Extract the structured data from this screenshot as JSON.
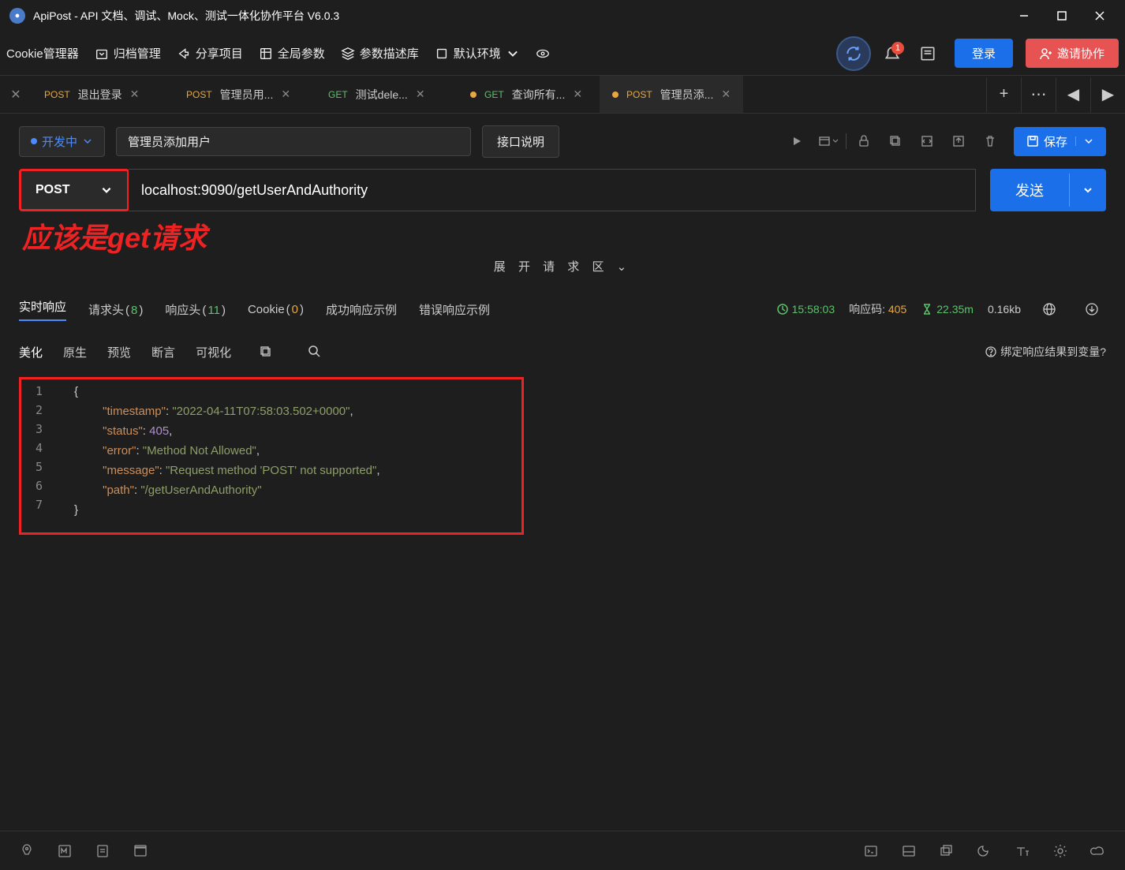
{
  "title": "ApiPost - API 文档、调试、Mock、测试一体化协作平台 V6.0.3",
  "toolbar": {
    "cookie_manager": "Cookie管理器",
    "archive": "归档管理",
    "share": "分享项目",
    "global_params": "全局参数",
    "param_lib": "参数描述库",
    "env": "默认环境",
    "login": "登录",
    "invite": "邀请协作",
    "badge": "1"
  },
  "tabs": [
    {
      "method": "POST",
      "method_class": "post",
      "label": "退出登录",
      "dirty": false,
      "active": false
    },
    {
      "method": "POST",
      "method_class": "post",
      "label": "管理员用...",
      "dirty": false,
      "active": false
    },
    {
      "method": "GET",
      "method_class": "get",
      "label": "测试dele...",
      "dirty": false,
      "active": false
    },
    {
      "method": "GET",
      "method_class": "get",
      "label": "查询所有...",
      "dirty": true,
      "active": false
    },
    {
      "method": "POST",
      "method_class": "post",
      "label": "管理员添...",
      "dirty": true,
      "active": true
    }
  ],
  "api": {
    "status": "开发中",
    "name": "管理员添加用户",
    "desc_btn": "接口说明",
    "save": "保存",
    "method": "POST",
    "url": "localhost:9090/getUserAndAuthority",
    "send": "发送"
  },
  "annotation": "应该是get请求",
  "expand_label": "展 开 请 求 区",
  "response": {
    "tabs": {
      "realtime": "实时响应",
      "req_headers": "请求头",
      "req_headers_count": "8",
      "resp_headers": "响应头",
      "resp_headers_count": "11",
      "cookie": "Cookie",
      "cookie_count": "0",
      "success_example": "成功响应示例",
      "error_example": "错误响应示例"
    },
    "status": {
      "time": "15:58:03",
      "code_label": "响应码:",
      "code_value": "405",
      "duration": "22.35m",
      "size": "0.16kb"
    },
    "subtabs": {
      "beautify": "美化",
      "raw": "原生",
      "preview": "预览",
      "assert": "断言",
      "visualize": "可视化"
    },
    "bind_var": "绑定响应结果到变量?",
    "body": {
      "timestamp": "2022-04-11T07:58:03.502+0000",
      "status": 405,
      "error": "Method Not Allowed",
      "message": "Request method 'POST' not supported",
      "path": "/getUserAndAuthority"
    }
  }
}
